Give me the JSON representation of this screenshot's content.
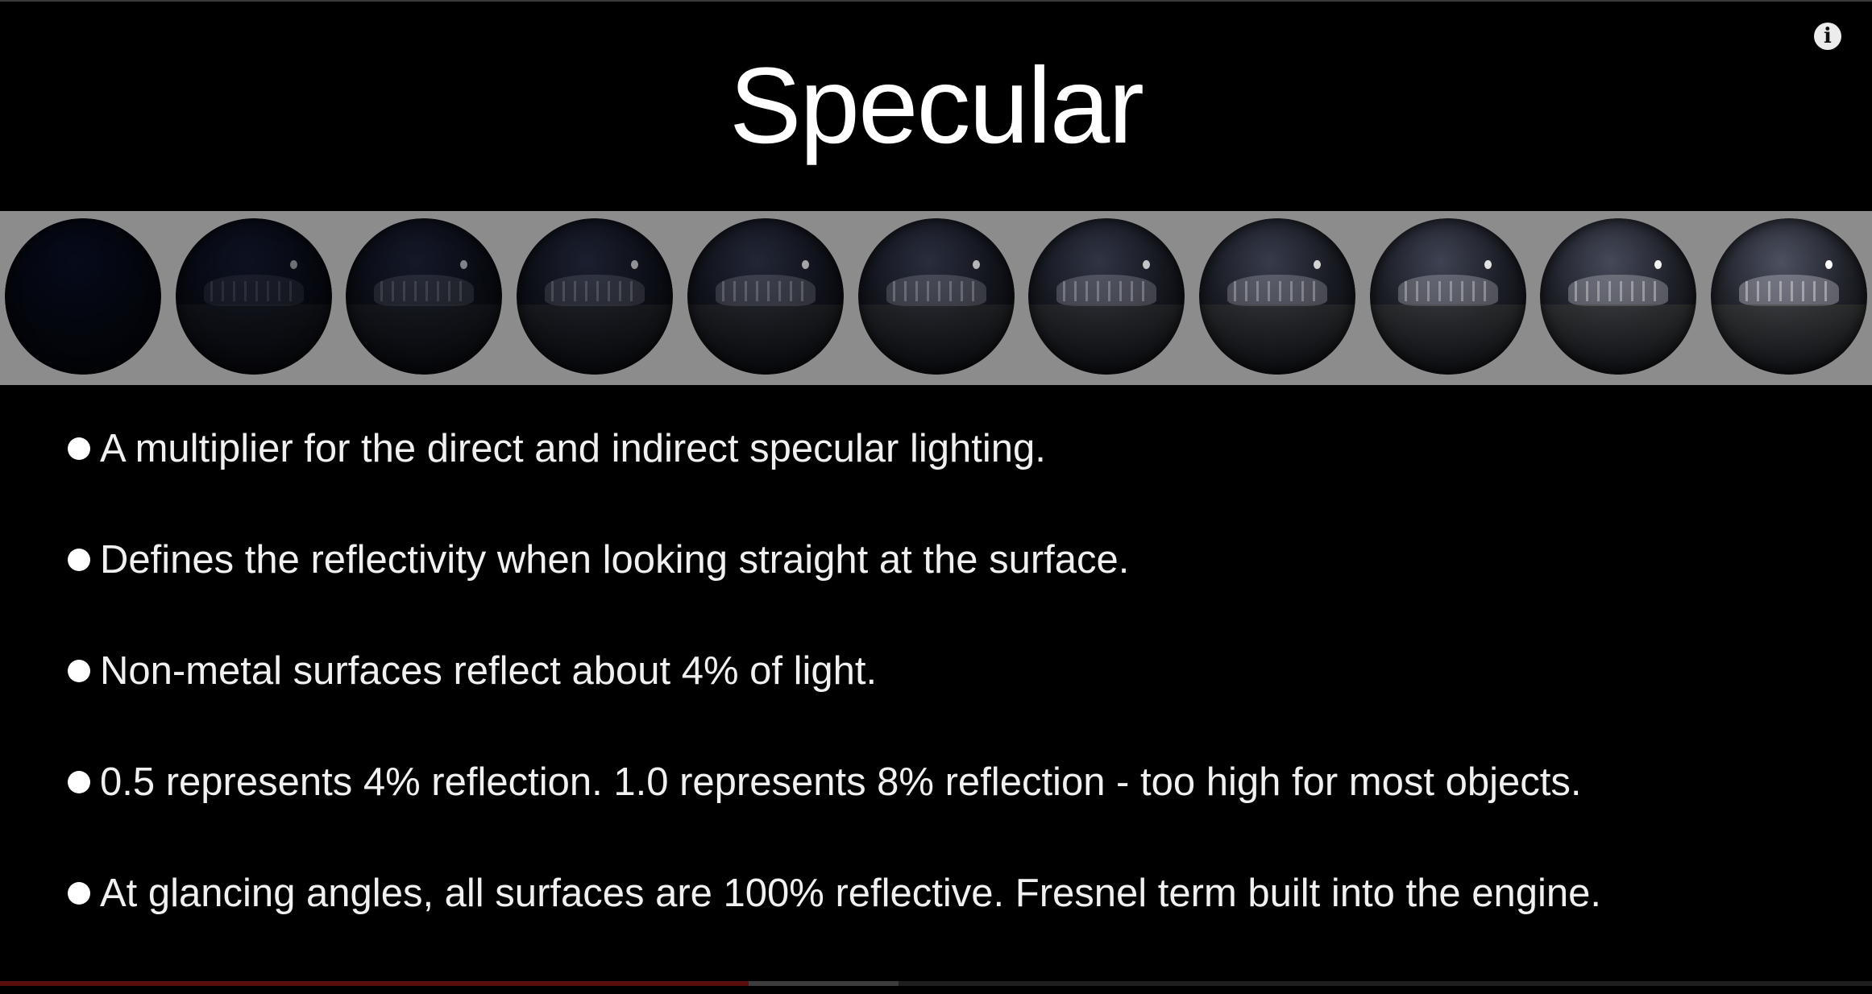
{
  "slide": {
    "title": "Specular",
    "bullets": [
      "A multiplier for the direct and indirect specular lighting.",
      "Defines the reflectivity when looking straight at the surface.",
      "Non-metal surfaces reflect about 4% of light.",
      "0.5 represents 4% reflection.  1.0 represents 8% reflection - too high for most objects.",
      "At glancing angles, all surfaces are 100% reflective.  Fresnel term built into the engine."
    ],
    "sphere_count": 11,
    "sphere_reflectivity_levels": [
      0,
      0.1,
      0.2,
      0.3,
      0.4,
      0.5,
      0.6,
      0.7,
      0.8,
      0.9,
      1.0
    ]
  },
  "player": {
    "info_icon": "info-icon",
    "info_glyph": "i",
    "progress_played_fraction": 0.4,
    "progress_buffered_fraction": 0.48
  },
  "colors": {
    "background": "#000000",
    "strip": "#8c8c8c",
    "text": "#f0f0f0",
    "progress_played": "#5a0d0d"
  }
}
